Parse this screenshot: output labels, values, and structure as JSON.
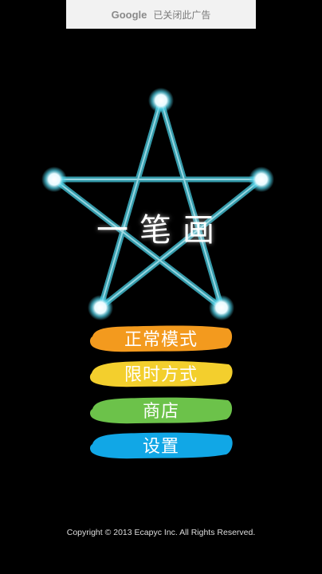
{
  "ad": {
    "brand": "Google",
    "text": "已关闭此广告"
  },
  "game": {
    "title": "一笔画"
  },
  "menu": [
    {
      "label": "正常模式",
      "color": "#f39a1e"
    },
    {
      "label": "限时方式",
      "color": "#f3cf2d"
    },
    {
      "label": "商店",
      "color": "#6cc24a"
    },
    {
      "label": "设置",
      "color": "#11a7e6"
    }
  ],
  "footer": {
    "copyright": "Copyright © 2013 Ecapyc Inc. All Rights Reserved."
  },
  "colors": {
    "star_line": "#3fb6c8",
    "node": "#ffffff",
    "background": "#000000"
  }
}
